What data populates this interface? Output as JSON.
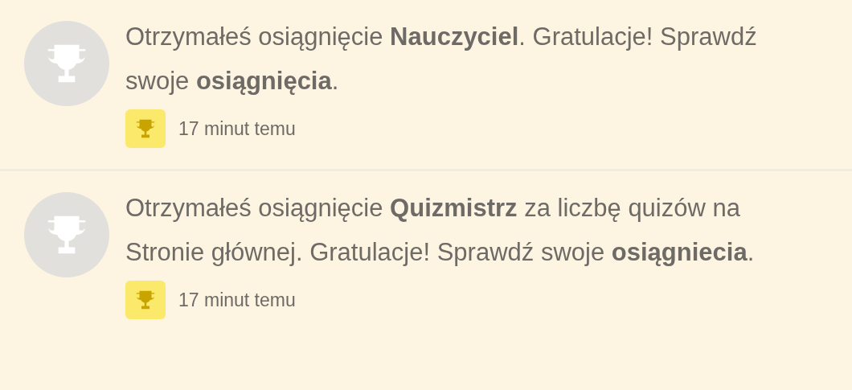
{
  "notifications": [
    {
      "message": "Otrzymałeś osiągnięcie **Nauczyciel**. Gratulacje! Sprawdź swoje **osiągnięcia**.",
      "time": "17 minut temu"
    },
    {
      "message": "Otrzymałeś osiągnięcie **Quizmistrz** za liczbę quizów na Stronie głównej. Gratulacje! Sprawdź swoje **osiągniecia**.",
      "time": "17 minut temu"
    }
  ]
}
